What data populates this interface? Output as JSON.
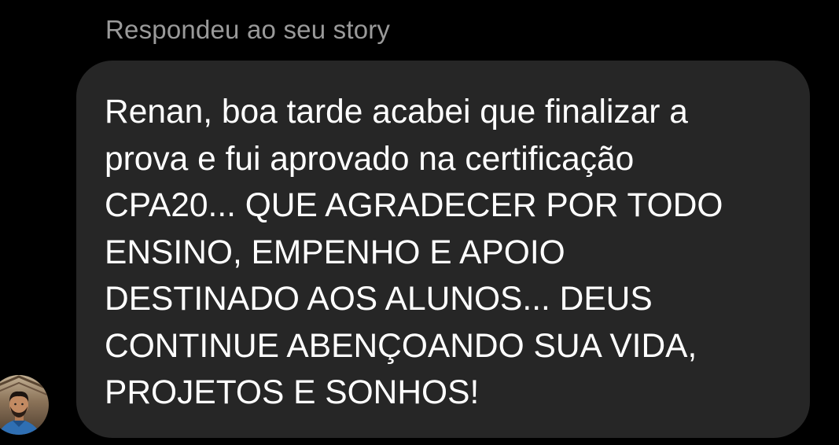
{
  "story_reply": {
    "caption": "Respondeu ao seu story"
  },
  "message": {
    "lines": [
      "Renan, boa tarde acabei que finalizar a",
      "prova e fui aprovado na certificação",
      "CPA20... QUE AGRADECER POR TODO",
      "ENSINO, EMPENHO E APOIO",
      "DESTINADO AOS ALUNOS... DEUS",
      "CONTINUE ABENÇOANDO SUA VIDA,",
      "PROJETOS E SONHOS!"
    ]
  },
  "colors": {
    "background": "#000000",
    "bubble": "#262626",
    "caption_text": "#9a9a9a",
    "message_text": "#ffffff"
  }
}
